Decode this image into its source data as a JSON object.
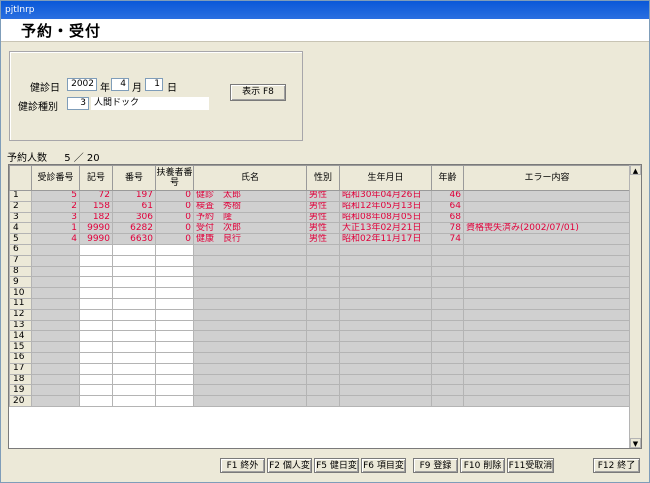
{
  "window": {
    "title": "pjtInrp"
  },
  "header": {
    "title": "予約・受付"
  },
  "form": {
    "date_label": "健診日",
    "year": "2002",
    "year_unit": "年",
    "month": "4",
    "month_unit": "月",
    "day": "1",
    "day_unit": "日",
    "type_label": "健診種別",
    "type_code": "3",
    "type_name": "人間ドック",
    "show_button": "表示 F8"
  },
  "summary": {
    "label": "予約人数",
    "value": "5 ／ 20"
  },
  "table": {
    "headers": [
      "受診番号",
      "記号",
      "番号",
      "扶養者番号",
      "氏名",
      "性別",
      "生年月日",
      "年齢",
      "エラー内容"
    ],
    "row_numbers": [
      "1",
      "2",
      "3",
      "4",
      "5",
      "6",
      "7",
      "8",
      "9",
      "10",
      "11",
      "12",
      "13",
      "14",
      "15",
      "16",
      "17",
      "18",
      "19",
      "20"
    ],
    "rows": [
      [
        "5",
        "72",
        "197",
        "0",
        "健診　太郎",
        "男性",
        "昭和30年04月26日",
        "46",
        ""
      ],
      [
        "2",
        "158",
        "61",
        "0",
        "検査　秀樹",
        "男性",
        "昭和12年05月13日",
        "64",
        ""
      ],
      [
        "3",
        "182",
        "306",
        "0",
        "予約　隆",
        "男性",
        "昭和08年08月05日",
        "68",
        ""
      ],
      [
        "1",
        "9990",
        "6282",
        "0",
        "受付　次郎",
        "男性",
        "大正13年02月21日",
        "78",
        "資格喪失済み(2002/07/01)"
      ],
      [
        "4",
        "9990",
        "6630",
        "0",
        "健康　良行",
        "男性",
        "昭和02年11月17日",
        "74",
        ""
      ]
    ]
  },
  "fkeys": [
    "F1 終外",
    "F2 個人変",
    "F5 健日変",
    "F6 項目変",
    "F9 登録",
    "F10 削除",
    "F11受取消",
    "F12 終了"
  ],
  "icons": {
    "scroll_up": "scroll-up-icon",
    "scroll_down": "scroll-down-icon"
  },
  "colors": {
    "data_text": "#e0003a"
  }
}
